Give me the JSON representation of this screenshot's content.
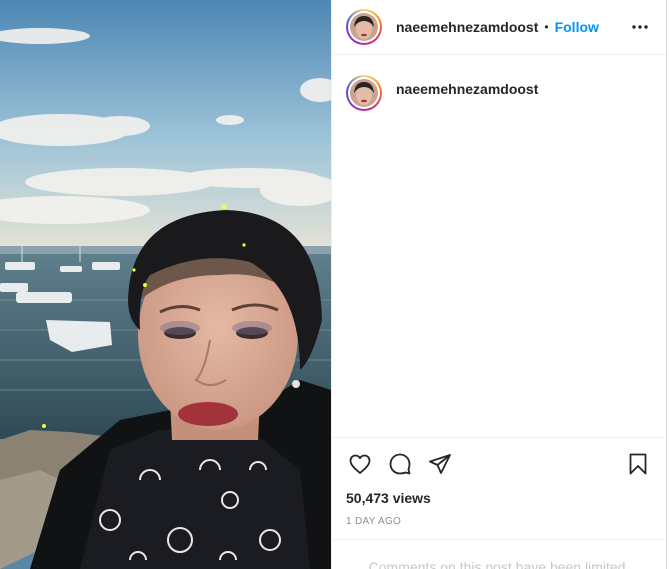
{
  "post": {
    "username": "naeemehnezamdoost",
    "separator": "•",
    "follow_label": "Follow",
    "caption_username": "naeemehnezamdoost",
    "views": "50,473 views",
    "timestamp": "1 DAY AGO",
    "comments_notice": "Comments on this post have been limited."
  },
  "icons": {
    "more": "more-options-icon",
    "like": "heart-icon",
    "comment": "comment-icon",
    "share": "paper-plane-icon",
    "save": "bookmark-icon"
  },
  "colors": {
    "follow_blue": "#0095f6",
    "text_primary": "#262626",
    "text_secondary": "#8e8e8e",
    "border": "#efefef"
  }
}
